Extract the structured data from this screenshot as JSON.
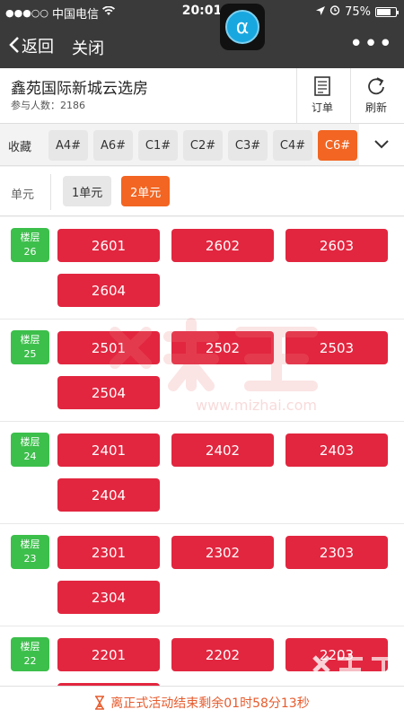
{
  "status_bar": {
    "signal": "●●●○○",
    "carrier": "中国电信",
    "time": "20:01",
    "battery": "75%",
    "battery_level": 0.75
  },
  "nav": {
    "back_label": "返回",
    "close_label": "关闭",
    "more_label": "•••"
  },
  "app_icon_glyph": "α",
  "header": {
    "title": "鑫苑国际新城云选房",
    "participants_label": "参与人数：2186",
    "order_label": "订单",
    "refresh_label": "刷新"
  },
  "building_tabs": {
    "favorites_label": "收藏",
    "items": [
      "A4#",
      "A6#",
      "C1#",
      "C2#",
      "C3#",
      "C4#",
      "C6#"
    ],
    "selected": "C6#"
  },
  "units": {
    "label": "单元",
    "items": [
      "1单元",
      "2单元"
    ],
    "selected": "2单元"
  },
  "floors": [
    {
      "badge": "楼层",
      "number": "26",
      "rooms": [
        "2601",
        "2602",
        "2603",
        "2604"
      ]
    },
    {
      "badge": "楼层",
      "number": "25",
      "rooms": [
        "2501",
        "2502",
        "2503",
        "2504"
      ]
    },
    {
      "badge": "楼层",
      "number": "24",
      "rooms": [
        "2401",
        "2402",
        "2403",
        "2404"
      ]
    },
    {
      "badge": "楼层",
      "number": "23",
      "rooms": [
        "2301",
        "2302",
        "2303",
        "2304"
      ]
    },
    {
      "badge": "楼层",
      "number": "22",
      "rooms": [
        "2201",
        "2202",
        "2203"
      ]
    }
  ],
  "watermark": {
    "url": "www.mizhai.com"
  },
  "countdown": {
    "text": "离正式活动结束剩余01时58分13秒"
  },
  "colors": {
    "dark_bar": "#3a3a3a",
    "accent_orange": "#f26522",
    "room_red": "#e2263f",
    "floor_green": "#3cbf4b",
    "countdown_text": "#e65b2d"
  }
}
